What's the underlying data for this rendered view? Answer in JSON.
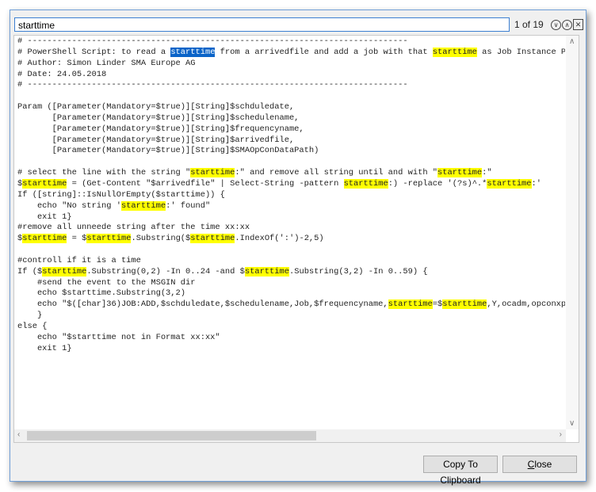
{
  "search": {
    "value": "starttime",
    "match_count": "1 of 19"
  },
  "icons": {
    "next": "chevron-down-circle-icon",
    "prev": "chevron-up-circle-icon",
    "close": "close-icon"
  },
  "code_lines": [
    [
      {
        "t": "# -----------------------------------------------------------------------------"
      }
    ],
    [
      {
        "t": "# PowerShell Script: to read a "
      },
      {
        "t": "starttime",
        "h": "current"
      },
      {
        "t": " from a arrivedfile and add a job with that "
      },
      {
        "t": "starttime",
        "h": "match"
      },
      {
        "t": " as Job Instance Pr"
      }
    ],
    [
      {
        "t": "# Author: Simon Linder SMA Europe AG"
      }
    ],
    [
      {
        "t": "# Date: 24.05.2018"
      }
    ],
    [
      {
        "t": "# -----------------------------------------------------------------------------"
      }
    ],
    [
      {
        "t": ""
      }
    ],
    [
      {
        "t": "Param ([Parameter(Mandatory=$true)][String]$schduledate,"
      }
    ],
    [
      {
        "t": "       [Parameter(Mandatory=$true)][String]$schedulename,"
      }
    ],
    [
      {
        "t": "       [Parameter(Mandatory=$true)][String]$frequencyname,"
      }
    ],
    [
      {
        "t": "       [Parameter(Mandatory=$true)][String]$arrivedfile,"
      }
    ],
    [
      {
        "t": "       [Parameter(Mandatory=$true)][String]$SMAOpConDataPath)"
      }
    ],
    [
      {
        "t": ""
      }
    ],
    [
      {
        "t": "# select the line with the string \""
      },
      {
        "t": "starttime",
        "h": "match"
      },
      {
        "t": ":\" and remove all string until and with \""
      },
      {
        "t": "starttime",
        "h": "match"
      },
      {
        "t": ":\""
      }
    ],
    [
      {
        "t": "$"
      },
      {
        "t": "starttime",
        "h": "match"
      },
      {
        "t": " = (Get-Content \"$arrivedfile\" | Select-String -pattern "
      },
      {
        "t": "starttime",
        "h": "match"
      },
      {
        "t": ":) -replace '(?s)^.*"
      },
      {
        "t": "starttime",
        "h": "match"
      },
      {
        "t": ":'"
      }
    ],
    [
      {
        "t": "If ([string]::IsNullOrEmpty($starttime)) {"
      }
    ],
    [
      {
        "t": "    echo \"No string '"
      },
      {
        "t": "starttime",
        "h": "match"
      },
      {
        "t": ":' found\""
      }
    ],
    [
      {
        "t": "    exit 1}"
      }
    ],
    [
      {
        "t": "#remove all unneede string after the time xx:xx"
      }
    ],
    [
      {
        "t": "$"
      },
      {
        "t": "starttime",
        "h": "match"
      },
      {
        "t": " = $"
      },
      {
        "t": "starttime",
        "h": "match"
      },
      {
        "t": ".Substring($"
      },
      {
        "t": "starttime",
        "h": "match"
      },
      {
        "t": ".IndexOf(':')-2,5)"
      }
    ],
    [
      {
        "t": ""
      }
    ],
    [
      {
        "t": "#controll if it is a time"
      }
    ],
    [
      {
        "t": "If ($"
      },
      {
        "t": "starttime",
        "h": "match"
      },
      {
        "t": ".Substring(0,2) -In 0..24 -and $"
      },
      {
        "t": "starttime",
        "h": "match"
      },
      {
        "t": ".Substring(3,2) -In 0..59) {"
      }
    ],
    [
      {
        "t": "    #send the event to the MSGIN dir"
      }
    ],
    [
      {
        "t": "    echo $starttime.Substring(3,2)"
      }
    ],
    [
      {
        "t": "    echo \"$([char]36)JOB:ADD,$schduledate,$schedulename,Job,$frequencyname,"
      },
      {
        "t": "starttime",
        "h": "match"
      },
      {
        "t": "=$"
      },
      {
        "t": "starttime",
        "h": "match"
      },
      {
        "t": ",Y,ocadm,opconxps"
      }
    ],
    [
      {
        "t": "    }"
      }
    ],
    [
      {
        "t": "else {"
      }
    ],
    [
      {
        "t": "    echo \"$starttime not in Format xx:xx\""
      }
    ],
    [
      {
        "t": "    exit 1}"
      }
    ]
  ],
  "buttons": {
    "copy": "Copy To Clipboard",
    "close": "Close"
  },
  "colors": {
    "match_highlight": "#ffff00",
    "current_match": "#0a64c8"
  }
}
